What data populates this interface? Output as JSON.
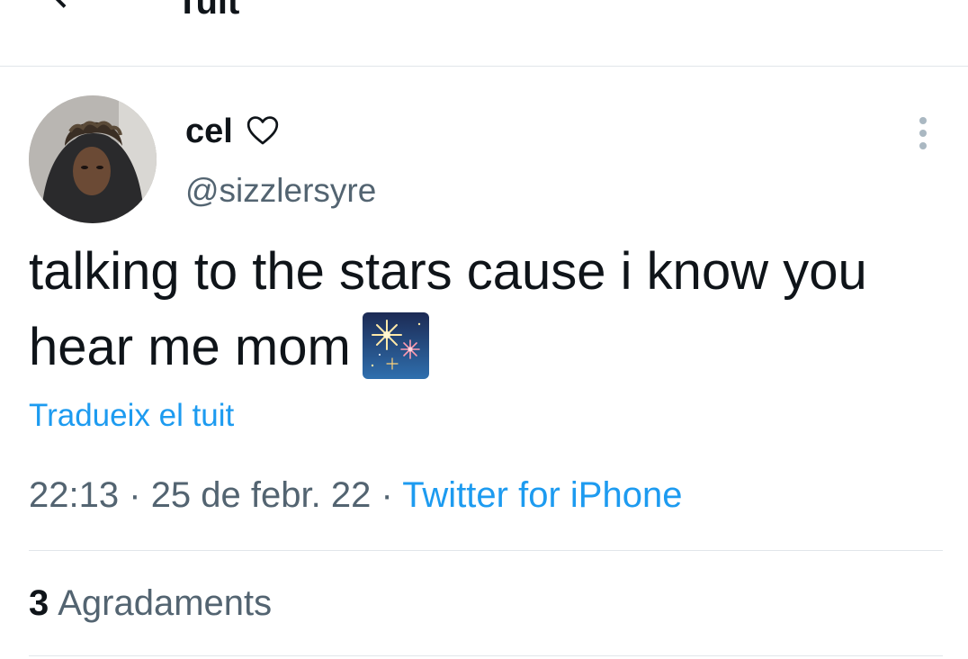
{
  "header": {
    "title": "Tuit",
    "back_icon": "arrow-left-icon"
  },
  "tweet": {
    "author": {
      "display_name": "cel",
      "name_emoji_icon": "heart-outline-icon",
      "handle": "@sizzlersyre"
    },
    "more_icon": "more-vertical-icon",
    "text": "talking to the stars cause i know you hear me mom",
    "emoji_icon": "fireworks-icon",
    "translate_label": "Tradueix el tuit",
    "time": "22:13",
    "separator": "·",
    "date": "25 de febr. 22",
    "source": "Twitter for iPhone",
    "likes_count": "3",
    "likes_label": "Agradaments"
  },
  "colors": {
    "accent": "#1d9bf0",
    "secondary_text": "#536471",
    "primary_text": "#0f1419",
    "divider": "#e1e6ea"
  }
}
